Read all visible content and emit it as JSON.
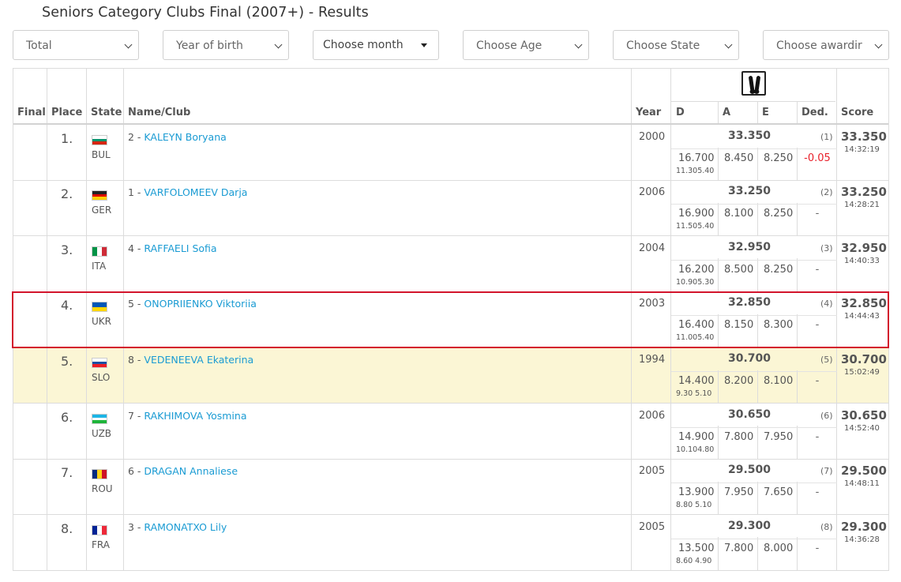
{
  "page": {
    "title": "Seniors Category Clubs Final (2007+) - Results"
  },
  "filters": [
    {
      "label": "Total",
      "control": "select"
    },
    {
      "label": "Year of birth",
      "control": "select"
    },
    {
      "label": "Choose month",
      "control": "dropdown"
    },
    {
      "label": "Choose Age",
      "control": "select"
    },
    {
      "label": "Choose State",
      "control": "select"
    },
    {
      "label": "Choose awardir",
      "control": "select"
    }
  ],
  "table": {
    "headers": {
      "final": "Final",
      "place": "Place",
      "state": "State",
      "name": "Name/Club",
      "year": "Year",
      "d": "D",
      "a": "A",
      "e": "E",
      "ded": "Ded.",
      "score": "Score"
    },
    "apparatus_icon": "clubs-icon",
    "rows": [
      {
        "place": "1.",
        "state": "BUL",
        "flag": "bul",
        "num": "2 - ",
        "name": "KALEYN Boryana",
        "year": "2000",
        "total": "33.350",
        "rank": "(1)",
        "d": "16.700",
        "dsub": "11.305.40",
        "a": "8.450",
        "e": "8.250",
        "ded": "-0.05",
        "score": "33.350",
        "time": "14:32:19"
      },
      {
        "place": "2.",
        "state": "GER",
        "flag": "ger",
        "num": "1 - ",
        "name": "VARFOLOMEEV Darja",
        "year": "2006",
        "total": "33.250",
        "rank": "(2)",
        "d": "16.900",
        "dsub": "11.505.40",
        "a": "8.100",
        "e": "8.250",
        "ded": "-",
        "score": "33.250",
        "time": "14:28:21"
      },
      {
        "place": "3.",
        "state": "ITA",
        "flag": "ita",
        "num": "4 - ",
        "name": "RAFFAELI Sofia",
        "year": "2004",
        "total": "32.950",
        "rank": "(3)",
        "d": "16.200",
        "dsub": "10.905.30",
        "a": "8.500",
        "e": "8.250",
        "ded": "-",
        "score": "32.950",
        "time": "14:40:33"
      },
      {
        "place": "4.",
        "state": "UKR",
        "flag": "ukr",
        "num": "5 - ",
        "name": "ONOPRIIENKO Viktoriia",
        "year": "2003",
        "total": "32.850",
        "rank": "(4)",
        "d": "16.400",
        "dsub": "11.005.40",
        "a": "8.150",
        "e": "8.300",
        "ded": "-",
        "score": "32.850",
        "time": "14:44:43"
      },
      {
        "place": "5.",
        "state": "SLO",
        "flag": "slo",
        "num": "8 - ",
        "name": "VEDENEEVA Ekaterina",
        "year": "1994",
        "total": "30.700",
        "rank": "(5)",
        "d": "14.400",
        "dsub": "9.30 5.10",
        "a": "8.200",
        "e": "8.100",
        "ded": "-",
        "score": "30.700",
        "time": "15:02:49"
      },
      {
        "place": "6.",
        "state": "UZB",
        "flag": "uzb",
        "num": "7 - ",
        "name": "RAKHIMOVA Yosmina",
        "year": "2006",
        "total": "30.650",
        "rank": "(6)",
        "d": "14.900",
        "dsub": "10.104.80",
        "a": "7.800",
        "e": "7.950",
        "ded": "-",
        "score": "30.650",
        "time": "14:52:40"
      },
      {
        "place": "7.",
        "state": "ROU",
        "flag": "rou",
        "num": "6 - ",
        "name": "DRAGAN Annaliese",
        "year": "2005",
        "total": "29.500",
        "rank": "(7)",
        "d": "13.900",
        "dsub": "8.80 5.10",
        "a": "7.950",
        "e": "7.650",
        "ded": "-",
        "score": "29.500",
        "time": "14:48:11"
      },
      {
        "place": "8.",
        "state": "FRA",
        "flag": "fra",
        "num": "3 - ",
        "name": "RAMONATXO Lily",
        "year": "2005",
        "total": "29.300",
        "rank": "(8)",
        "d": "13.500",
        "dsub": "8.60 4.90",
        "a": "7.800",
        "e": "8.000",
        "ded": "-",
        "score": "29.300",
        "time": "14:36:28"
      }
    ],
    "highlighted_place": "5.",
    "selected_place": "4."
  },
  "colors": {
    "link": "#1a9bd3",
    "highlight_row": "#fbf6d5",
    "selection_border": "#d3142c",
    "deduction_negative": "#e8202a"
  }
}
